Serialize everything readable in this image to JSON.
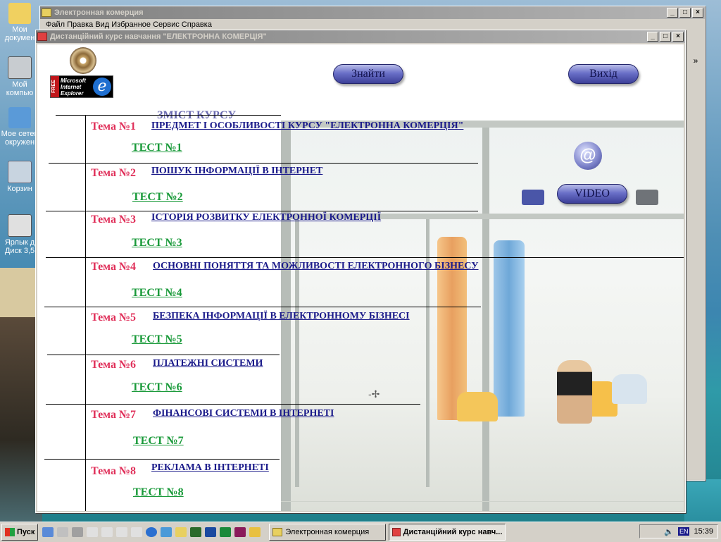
{
  "desktop": {
    "icons": [
      {
        "label": "Мои докумен",
        "icon": "folder-icon"
      },
      {
        "label": "Мой компью",
        "icon": "computer-icon"
      },
      {
        "label": "Мое сетев окружен",
        "icon": "network-icon"
      },
      {
        "label": "Корзин",
        "icon": "recycle-bin-icon"
      },
      {
        "label": "Ярлык д Диск 3,5",
        "icon": "floppy-shortcut-icon"
      }
    ]
  },
  "back_window": {
    "title": "Электронная комерция",
    "menu_text": "Файл   Правка   Вид   Избранное   Сервис   Справка",
    "chevron": "»"
  },
  "front_window": {
    "title": "Дистанційний курс навчання \"ЕЛЕКТРОННА КОМЕРЦІЯ\""
  },
  "page": {
    "heading": "ЗМІСТ КУРСУ",
    "search_button": "Знайти",
    "exit_button": "Вихід",
    "video_button": "VIDEO",
    "logo": {
      "free": "FREE",
      "line1": "Microsoft",
      "line2": "Internet",
      "line3": "Explorer"
    },
    "topics": [
      {
        "num": "Тема №1",
        "title": "ПРЕДМЕТ І ОСОБЛИВОСТІ КУРСУ \"ЕЛЕКТРОННА КОМЕРЦІЯ\"",
        "test": "ТЕСТ №1"
      },
      {
        "num": "Тема №2",
        "title": "ПОШУК ІНФОРМАЦІЇ В ІНТЕРНЕТ",
        "test": "ТЕСТ №2"
      },
      {
        "num": "Тема №3",
        "title": "ІСТОРІЯ РОЗВИТКУ ЕЛЕКТРОННОЇ КОМЕРЦІЇ",
        "test": "ТЕСТ №3"
      },
      {
        "num": "Тема №4",
        "title": "ОСНОВНІ ПОНЯТТЯ ТА МОЖЛИВОСТІ ЕЛЕКТРОННОГО БІЗНЕСУ",
        "test": "ТЕСТ №4"
      },
      {
        "num": "Тема №5",
        "title": "БЕЗПЕКА ІНФОРМАЦІЇ В ЕЛЕКТРОННОМУ БІЗНЕСІ",
        "test": "ТЕСТ №5"
      },
      {
        "num": "Тема №6",
        "title": "ПЛАТЕЖНІ СИСТЕМИ",
        "test": "ТЕСТ №6"
      },
      {
        "num": "Тема №7",
        "title": "ФІНАНСОВІ СИСТЕМИ В ІНТЕРНЕТІ",
        "test": "ТЕСТ №7"
      },
      {
        "num": "Тема №8",
        "title": "РЕКЛАМА В ІНТЕРНЕТІ",
        "test": "ТЕСТ №8"
      }
    ]
  },
  "taskbar": {
    "start_label": "Пуск",
    "tasks": [
      "Электронная комерция",
      "Дистанційний курс навч..."
    ],
    "lang": "EN",
    "clock": "15:39"
  },
  "colors": {
    "topic_num": "#e0305a",
    "topic_link": "#1a1a8a",
    "test_link": "#1a9a3a",
    "heading": "#6a6ab0"
  }
}
